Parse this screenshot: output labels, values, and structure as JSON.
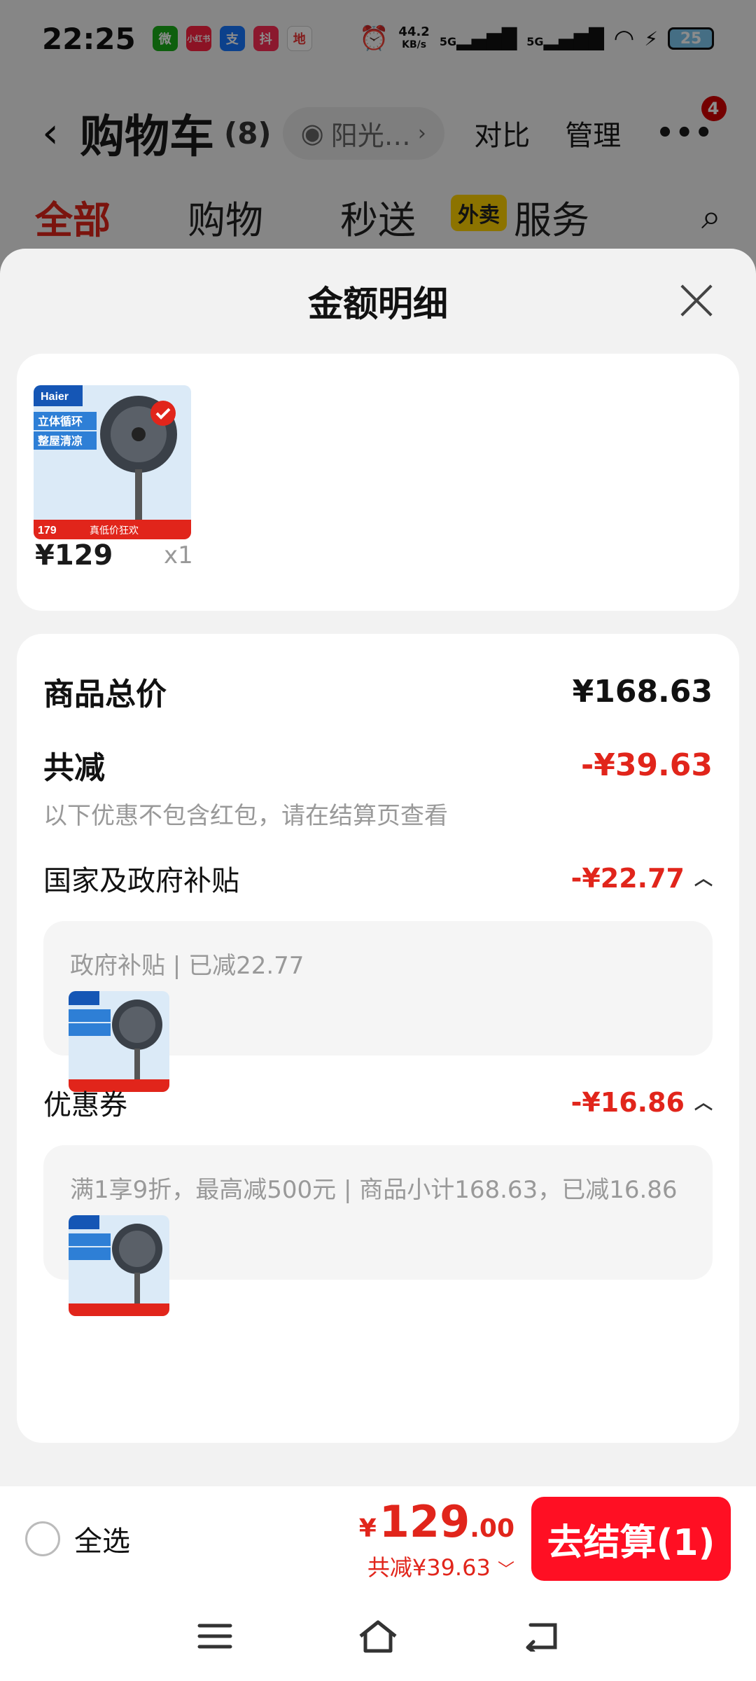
{
  "status_bar": {
    "time": "22:25",
    "apps": [
      "微",
      "小红书",
      "支",
      "抖",
      "地"
    ],
    "net_speed": "44.2",
    "net_unit": "KB/s",
    "sig1": "5G",
    "sig2": "5G",
    "battery": "25"
  },
  "cart": {
    "title": "购物车",
    "count": "(8)",
    "location": "阳光…",
    "compare": "对比",
    "manage": "管理",
    "badge": "4",
    "tabs": [
      "全部",
      "购物",
      "秒送",
      "服务"
    ],
    "tab_tag": "外卖"
  },
  "sheet": {
    "title": "金额明细",
    "product": {
      "price": "¥129",
      "qty": "x1"
    },
    "total_label": "商品总价",
    "total_value": "¥168.63",
    "discount_label": "共减",
    "discount_value": "-¥39.63",
    "discount_note": "以下优惠不包含红包，请在结算页查看",
    "subsidy_label": "国家及政府补贴",
    "subsidy_value": "-¥22.77",
    "subsidy_detail": "政府补贴 | 已减22.77",
    "coupon_label": "优惠券",
    "coupon_value": "-¥16.86",
    "coupon_detail": "满1享9折，最高减500元 | 商品小计168.63，已减16.86"
  },
  "thumbnail": {
    "brand": "Haier",
    "headline1": "立体循环",
    "headline2": "整屋清凉",
    "badge_price": "179",
    "promo": "真低价狂欢"
  },
  "bottom": {
    "select_all": "全选",
    "currency": "¥",
    "total_int": "129",
    "total_dec": ".00",
    "total_discount": "共减¥39.63",
    "checkout": "去结算(1)"
  },
  "colors": {
    "accent_red": "#e1251b",
    "checkout_red": "#ff0f23"
  }
}
